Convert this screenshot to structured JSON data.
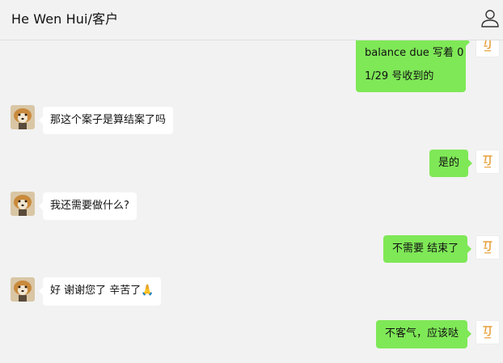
{
  "chat": {
    "title": "He Wen Hui/客户"
  },
  "icons": {
    "contact": "person-icon"
  },
  "messages": [
    {
      "from": "me",
      "lines": [
        "balance due  写着 0",
        "1/29 号收到的"
      ]
    },
    {
      "from": "them",
      "text": "那这个案子是算结案了吗"
    },
    {
      "from": "me",
      "text": "是的"
    },
    {
      "from": "them",
      "text": "我还需要做什么?"
    },
    {
      "from": "me",
      "text": "不需要 结束了"
    },
    {
      "from": "them",
      "text": "好 谢谢您了 辛苦了🙏"
    },
    {
      "from": "me",
      "text": "不客气，应该哒"
    }
  ],
  "colors": {
    "outgoing_bubble": "#7fe857",
    "incoming_bubble": "#ffffff",
    "background": "#f2f2f2"
  }
}
